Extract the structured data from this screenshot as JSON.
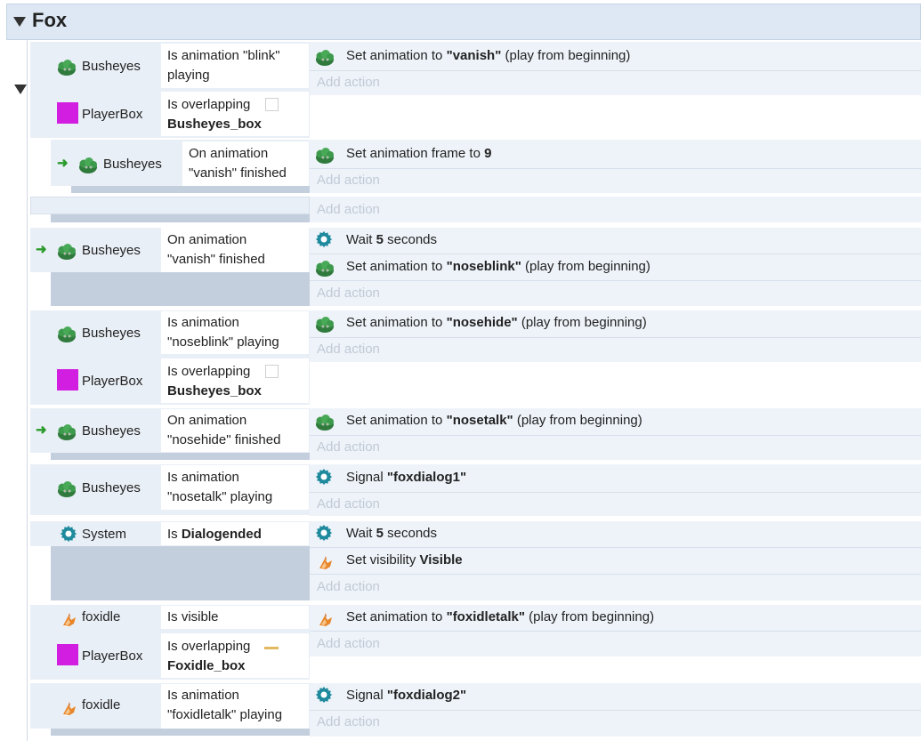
{
  "group": {
    "title": "Fox"
  },
  "add_action_label": "Add action",
  "colors": {
    "playerbox": "#d11ee0",
    "accent_gear": "#1f8a9e"
  },
  "events": [
    {
      "conditions": [
        {
          "object": "Busheyes",
          "icon": "bush-icon",
          "lines": [
            "Is animation \"blink\"",
            "playing"
          ]
        },
        {
          "object": "PlayerBox",
          "icon": "square-icon",
          "lines": [
            "Is overlapping",
            "Busheyes_box"
          ]
        }
      ],
      "actions": [
        {
          "icon": "bush-icon",
          "prefix": "Set animation to ",
          "bold": "\"vanish\"",
          "suffix": " (play from beginning)"
        }
      ]
    },
    {
      "conditions": [
        {
          "object": "Busheyes",
          "icon": "bush-icon",
          "lines": [
            "On animation",
            "\"vanish\" finished"
          ]
        }
      ],
      "actions": [
        {
          "icon": "bush-icon",
          "prefix": "Set animation frame to ",
          "bold": "9",
          "suffix": ""
        }
      ]
    },
    {
      "conditions": [
        {
          "object": "Busheyes",
          "icon": "bush-icon",
          "lines": [
            "On animation",
            "\"vanish\" finished"
          ]
        }
      ],
      "actions": [
        {
          "icon": "gear-icon",
          "prefix": "Wait ",
          "bold": "5",
          "suffix": " seconds"
        },
        {
          "icon": "bush-icon",
          "prefix": "Set animation to ",
          "bold": "\"noseblink\"",
          "suffix": " (play from beginning)"
        }
      ]
    },
    {
      "conditions": [
        {
          "object": "Busheyes",
          "icon": "bush-icon",
          "lines": [
            "Is animation",
            "\"noseblink\" playing"
          ]
        },
        {
          "object": "PlayerBox",
          "icon": "square-icon",
          "lines": [
            "Is overlapping",
            "Busheyes_box"
          ]
        }
      ],
      "actions": [
        {
          "icon": "bush-icon",
          "prefix": "Set animation to ",
          "bold": "\"nosehide\"",
          "suffix": " (play from beginning)"
        }
      ]
    },
    {
      "conditions": [
        {
          "object": "Busheyes",
          "icon": "bush-icon",
          "lines": [
            "On animation",
            "\"nosehide\" finished"
          ]
        }
      ],
      "actions": [
        {
          "icon": "bush-icon",
          "prefix": "Set animation to ",
          "bold": "\"nosetalk\"",
          "suffix": " (play from beginning)"
        }
      ]
    },
    {
      "conditions": [
        {
          "object": "Busheyes",
          "icon": "bush-icon",
          "lines": [
            "Is animation",
            "\"nosetalk\" playing"
          ]
        }
      ],
      "actions": [
        {
          "icon": "gear-icon",
          "prefix": "Signal ",
          "bold": "\"foxdialog1\"",
          "suffix": ""
        }
      ]
    },
    {
      "conditions": [
        {
          "object": "System",
          "icon": "gear-icon",
          "prefix": "Is ",
          "bold": "Dialogended"
        }
      ],
      "actions": [
        {
          "icon": "gear-icon",
          "prefix": "Wait ",
          "bold": "5",
          "suffix": " seconds"
        },
        {
          "icon": "fox-icon",
          "prefix": "Set visibility ",
          "bold": "Visible",
          "suffix": ""
        }
      ]
    },
    {
      "conditions": [
        {
          "object": "foxidle",
          "icon": "fox-icon",
          "lines": [
            "Is visible"
          ]
        },
        {
          "object": "PlayerBox",
          "icon": "square-icon",
          "lines": [
            "Is overlapping",
            "Foxidle_box"
          ]
        }
      ],
      "actions": [
        {
          "icon": "fox-icon",
          "prefix": "Set animation to ",
          "bold": "\"foxidletalk\"",
          "suffix": " (play from beginning)"
        }
      ]
    },
    {
      "conditions": [
        {
          "object": "foxidle",
          "icon": "fox-icon",
          "lines": [
            "Is animation",
            "\"foxidletalk\" playing"
          ]
        }
      ],
      "actions": [
        {
          "icon": "gear-icon",
          "prefix": "Signal ",
          "bold": "\"foxdialog2\"",
          "suffix": ""
        }
      ]
    }
  ]
}
